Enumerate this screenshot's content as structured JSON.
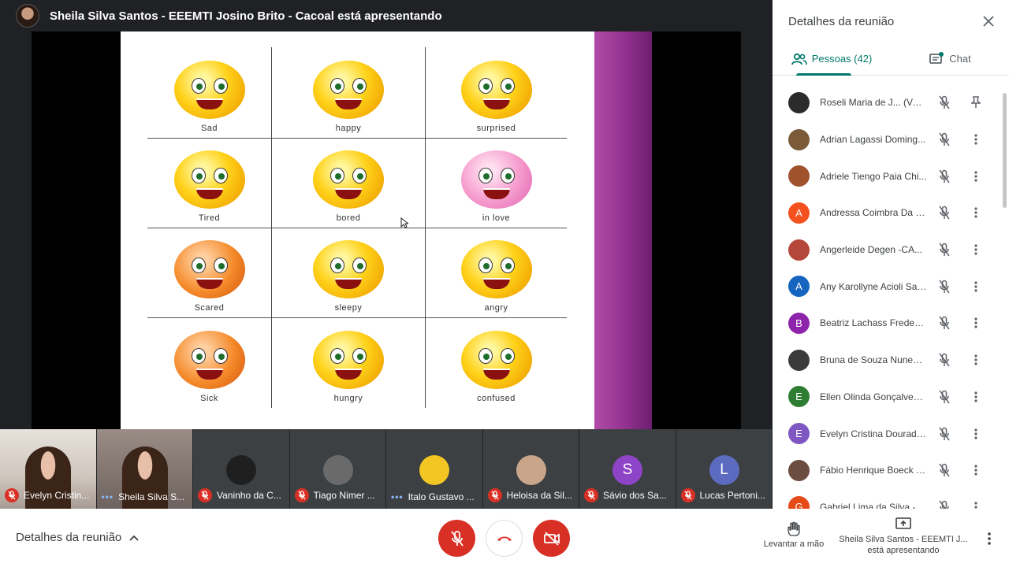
{
  "presenter": {
    "title": "Sheila Silva Santos - EEEMTI Josino Brito - Cacoal está apresentando"
  },
  "slide": {
    "cells": [
      {
        "label": "Sad",
        "face": "blue-tear"
      },
      {
        "label": "happy",
        "face": "yellow"
      },
      {
        "label": "surprised",
        "face": "yellow"
      },
      {
        "label": "Tired",
        "face": "yellow"
      },
      {
        "label": "bored",
        "face": "yellow"
      },
      {
        "label": "in love",
        "face": "pink"
      },
      {
        "label": "Scared",
        "face": "orange"
      },
      {
        "label": "sleepy",
        "face": "yellow"
      },
      {
        "label": "angry",
        "face": "yellow"
      },
      {
        "label": "Sick",
        "face": "orange"
      },
      {
        "label": "hungry",
        "face": "yellow"
      },
      {
        "label": "confused",
        "face": "yellow"
      }
    ]
  },
  "tiles": [
    {
      "name": "Evelyn Cristin...",
      "status": "muted",
      "kind": "video1"
    },
    {
      "name": "Sheila Silva S...",
      "status": "talking",
      "kind": "video2"
    },
    {
      "name": "Vaninho da C...",
      "status": "muted",
      "kind": "photo",
      "avatar_color": "#1f1f1f"
    },
    {
      "name": "Tiago Nimer ...",
      "status": "muted",
      "kind": "photo",
      "avatar_color": "#6a6a6a"
    },
    {
      "name": "Italo Gustavo ...",
      "status": "talking",
      "kind": "photo",
      "avatar_color": "#f3c623"
    },
    {
      "name": "Heloisa da Sil...",
      "status": "muted",
      "kind": "photo",
      "avatar_color": "#c9a58a"
    },
    {
      "name": "Sávio dos Sa...",
      "status": "muted",
      "kind": "letter",
      "letter": "S",
      "avatar_color": "#8e44c7"
    },
    {
      "name": "Lucas Pertoni...",
      "status": "muted",
      "kind": "letter",
      "letter": "L",
      "avatar_color": "#5c6bc0"
    }
  ],
  "panel": {
    "title": "Detalhes da reunião",
    "tabs": {
      "people": "Pessoas (42)",
      "chat": "Chat"
    },
    "people": [
      {
        "name": "Roseli Maria de J... (Você)",
        "avatar_color": "#2b2b2b",
        "letter": "",
        "action": "pin"
      },
      {
        "name": "Adrian Lagassi Doming...",
        "avatar_color": "#7b5a3a",
        "letter": ""
      },
      {
        "name": "Adriele Tiengo Paia Chi...",
        "avatar_color": "#a0522d",
        "letter": ""
      },
      {
        "name": "Andressa Coimbra Da S...",
        "avatar_color": "#f4511e",
        "letter": "A"
      },
      {
        "name": "Angerleide Degen -CA...",
        "avatar_color": "#b5473a",
        "letter": ""
      },
      {
        "name": "Any Karollyne Acioli San...",
        "avatar_color": "#1565c0",
        "letter": "A"
      },
      {
        "name": "Beatriz Lachass Frederi...",
        "avatar_color": "#8e24aa",
        "letter": "B"
      },
      {
        "name": "Bruna de Souza Nunes -...",
        "avatar_color": "#3b3b3b",
        "letter": ""
      },
      {
        "name": "Ellen Olinda Gonçalves ...",
        "avatar_color": "#2e7d32",
        "letter": "E"
      },
      {
        "name": "Evelyn Cristina Dourado...",
        "avatar_color": "#7e57c2",
        "letter": "E"
      },
      {
        "name": "Fábio Henrique Boeck -...",
        "avatar_color": "#6d4c41",
        "letter": ""
      },
      {
        "name": "Gabriel Lima da Silva -C...",
        "avatar_color": "#e64a19",
        "letter": "G"
      }
    ]
  },
  "bottom": {
    "details_label": "Detalhes da reunião",
    "raise_hand": "Levantar a mão",
    "presenting_line1": "Sheila Silva Santos - EEEMTI J...",
    "presenting_line2": "está apresentando"
  },
  "colors": {
    "accent": "#00796b",
    "danger": "#d93025",
    "slide_strip": "#9c3a97"
  }
}
